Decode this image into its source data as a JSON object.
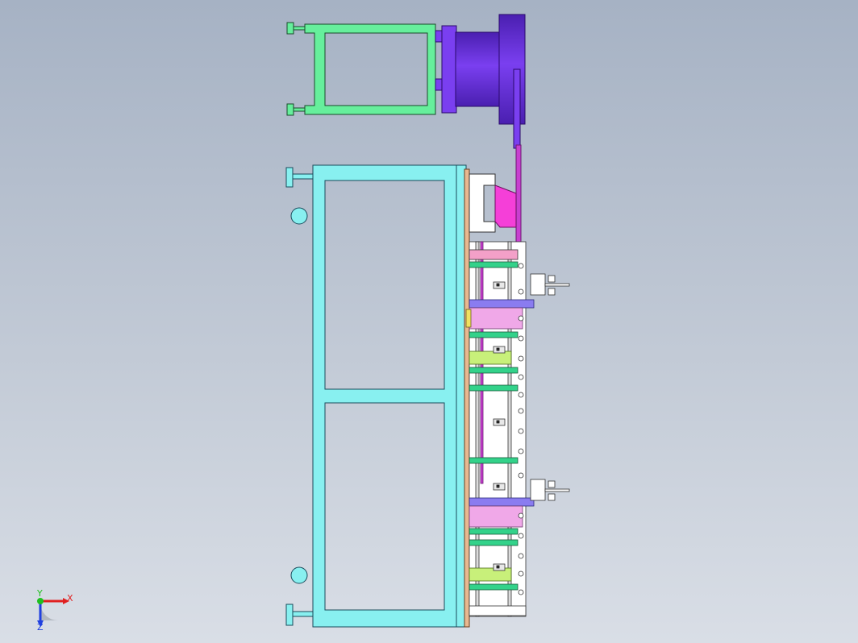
{
  "viewport": {
    "background_top": "#a6b2c4",
    "background_bottom": "#d9dee6"
  },
  "colors": {
    "upper_frame": "#66ef9c",
    "motor": "#7a3ff0",
    "motor_dark": "#4a1fb0",
    "base_frame": "#88f0f0",
    "pink_bracket": "#f53fd8",
    "magenta_rod": "#c83fd0",
    "green_block": "#33d28a",
    "lavender_block": "#8a7cf0",
    "light_pink": "#f0a8e8",
    "lime_block": "#c8f07a",
    "peach_plate": "#e8b890",
    "axis_x": "#e02020",
    "axis_y": "#20c020",
    "axis_z": "#2040e0"
  },
  "triad": {
    "x_label": "X",
    "y_label": "Y",
    "z_label": "Z"
  }
}
